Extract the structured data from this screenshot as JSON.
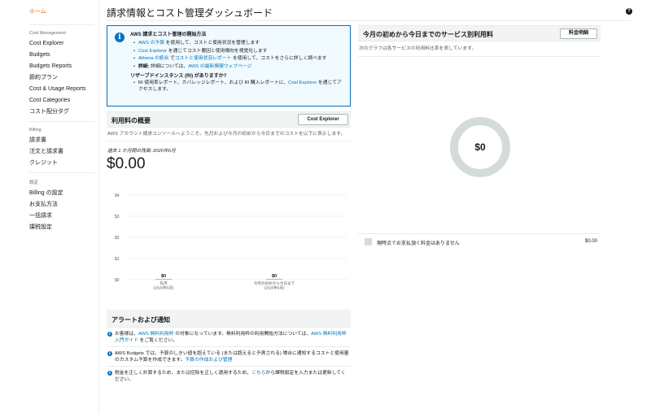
{
  "sidebar": {
    "home": "ホーム",
    "sections": [
      {
        "title": "Cost Management",
        "items": [
          "Cost Explorer",
          "Budgets",
          "Budgets Reports",
          "節約プラン",
          "Cost & Usage Reports",
          "Cost Categories",
          "コスト配分タグ"
        ]
      },
      {
        "title": "Billing",
        "items": [
          "請求書",
          "注文と請求書",
          "クレジット"
        ]
      },
      {
        "title": "設定",
        "items": [
          "Billing の設定",
          "お支払方法",
          "一括請求",
          "課税設定"
        ]
      }
    ]
  },
  "page": {
    "title": "請求情報とコスト管理ダッシュボード",
    "help_icon": "?"
  },
  "info": {
    "icon": "i",
    "heading": "AWS 請求とコスト管理の開始方法",
    "b1_link": "AWS の予算",
    "b1_text": " を使用して、コストと使用状況を管理します",
    "b2_link": "Cost Explorer",
    "b2_text": " を通じてコスト要因と使用傾向を視覚化します",
    "b3_link1": "Athena の統合",
    "b3_mid": " で",
    "b3_link2": "コストと使用状況レポート",
    "b3_text": " を使用して、コストをさらに詳しく調べます",
    "b4_bold": "詳細:",
    "b4_text": " 詳細については、",
    "b4_link": "AWS の最新情報ウェブページ",
    "ri_heading": "リザーブドインスタンス (RI) がありますか?",
    "ri_text1": "RI 使用率レポート、カバレッジレポート、および RI 購入レポートに、",
    "ri_link": "Cost Explorer",
    "ri_text2": " を通じてアクセスします。"
  },
  "usage": {
    "title": "利用料の概要",
    "button": "Cost Explorer",
    "desc": "AWS アカウント請求コンソールへようこそ。先月および今月の初めから今日までのコストを以下に表示します。",
    "month_label": "過去 1 か月間の残高: 2020年6月",
    "amount": "$0.00"
  },
  "chart_data": {
    "type": "bar",
    "categories": [
      "先月\n(2020年5月)",
      "今月の初めから今日まで\n(2020年6月)"
    ],
    "category_lines": [
      [
        "先月",
        "(2020年5月)"
      ],
      [
        "今月の初めから今日まで",
        "(2020年6月)"
      ]
    ],
    "values": [
      0,
      0
    ],
    "value_labels": [
      "$0",
      "$0"
    ],
    "y_ticks": [
      "$4",
      "$3",
      "$2",
      "$1",
      "$0"
    ],
    "ylim": [
      0,
      4
    ],
    "title": "",
    "xlabel": "",
    "ylabel": "",
    "grid": true
  },
  "alerts": {
    "title": "アラートおよび通知",
    "icon": "i",
    "a1_text": "お客様は、",
    "a1_link1": "AWS 無料利用枠",
    "a1_text2": " の対象になっています。無料利用枠の利用開始方法については、",
    "a1_link2": "AWS 無料利用枠入門ガイド",
    "a1_text3": " をご覧ください。",
    "a2_text": "AWS Budgets では、予算のしきい値を超えている (または超えると予測される) 場合に通知するコストと使用量のカスタム予算を作成できます。",
    "a2_link": "予算の作成および管理",
    "a3_text": "税金を正しく計算するため、または控除を正しく適用するため、",
    "a3_link": "こちら",
    "a3_text2": "から課税設定を入力または更新してください。"
  },
  "services": {
    "title": "今月の初めから今日までのサービス別利用料",
    "button": "料金明細",
    "desc": "次のグラフは各サービスの利用料比率を表しています。",
    "donut_center": "$0",
    "row_label": "現時点でお支払頂く料金はありません",
    "row_value": "$0.00",
    "colors": {
      "donut": "#d5dbdb",
      "swatch": "#d5dbdb"
    }
  },
  "colors": {
    "accent": "#ec7211",
    "link": "#0073bb",
    "info_bg": "#f1faff"
  }
}
